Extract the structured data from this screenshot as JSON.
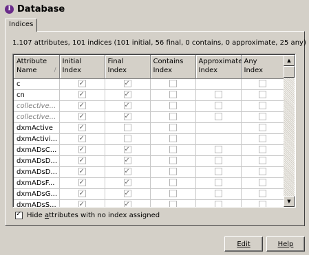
{
  "header": {
    "title": "Database",
    "icon": "info-icon"
  },
  "tabs": [
    {
      "label": "Indices",
      "active": true
    }
  ],
  "stats": "1.107 attributes, 101 indices (101 initial, 56 final, 0 contains, 0 approximate, 25 any)",
  "table": {
    "columns": [
      {
        "line1": "Attribute",
        "line2": "Name",
        "sort": "desc"
      },
      {
        "line1": "Initial",
        "line2": "Index"
      },
      {
        "line1": "Final",
        "line2": "Index"
      },
      {
        "line1": "Contains",
        "line2": "Index"
      },
      {
        "line1": "Approximate",
        "line2": "Index"
      },
      {
        "line1": "Any",
        "line2": "Index"
      }
    ],
    "rows": [
      {
        "name": "c",
        "italic": false,
        "cells": [
          1,
          1,
          0,
          null,
          0
        ]
      },
      {
        "name": "cn",
        "italic": false,
        "cells": [
          1,
          1,
          0,
          0,
          0
        ]
      },
      {
        "name": "collective...",
        "italic": true,
        "cells": [
          1,
          1,
          0,
          0,
          0
        ]
      },
      {
        "name": "collective...",
        "italic": true,
        "cells": [
          1,
          1,
          0,
          0,
          0
        ]
      },
      {
        "name": "dxmActive",
        "italic": false,
        "cells": [
          1,
          0,
          0,
          null,
          0
        ]
      },
      {
        "name": "dxmActivi...",
        "italic": false,
        "cells": [
          1,
          0,
          0,
          null,
          0
        ]
      },
      {
        "name": "dxmADsC...",
        "italic": false,
        "cells": [
          1,
          1,
          0,
          0,
          0
        ]
      },
      {
        "name": "dxmADsD...",
        "italic": false,
        "cells": [
          1,
          1,
          0,
          0,
          0
        ]
      },
      {
        "name": "dxmADsD...",
        "italic": false,
        "cells": [
          1,
          1,
          0,
          0,
          0
        ]
      },
      {
        "name": "dxmADsF...",
        "italic": false,
        "cells": [
          1,
          1,
          0,
          0,
          0
        ]
      },
      {
        "name": "dxmADsG...",
        "italic": false,
        "cells": [
          1,
          1,
          0,
          0,
          0
        ]
      },
      {
        "name": "dxmADsS...",
        "italic": false,
        "cells": [
          1,
          1,
          0,
          0,
          0
        ]
      }
    ]
  },
  "hide_option": {
    "label": "Hide attributes with no index assigned",
    "checked": true,
    "mnemonic": "a"
  },
  "buttons": {
    "edit": "Edit",
    "help": "Help"
  }
}
